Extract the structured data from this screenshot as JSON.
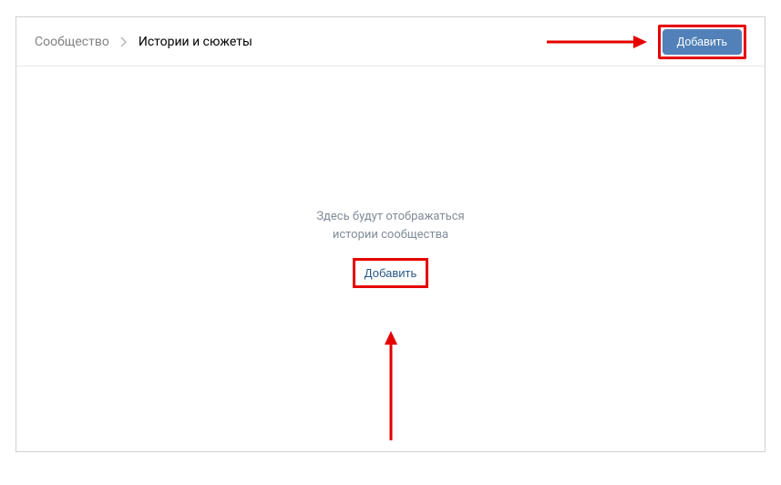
{
  "breadcrumb": {
    "root": "Сообщество",
    "current": "Истории и сюжеты"
  },
  "header": {
    "add_button": "Добавить"
  },
  "empty_state": {
    "line1": "Здесь будут отображаться",
    "line2": "истории сообщества",
    "add_link": "Добавить"
  }
}
